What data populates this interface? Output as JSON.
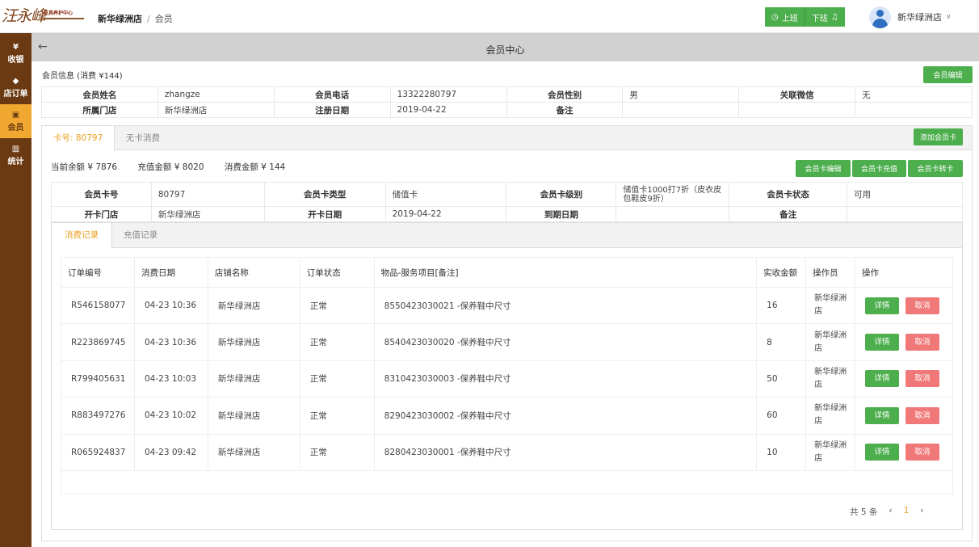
{
  "brand": {
    "logo_script": "汪永峰",
    "logo_sub": "皮具养护中心",
    "logo_tiny": "· · ·",
    "accent": "#6b3a12",
    "active": "#f0a830",
    "green": "#4cae4c"
  },
  "header": {
    "store": "新华绿洲店",
    "separator": "/",
    "page": "会员",
    "shift_on": "上班",
    "shift_off": "下班",
    "user": "新华绿洲店"
  },
  "sidebar": [
    {
      "icon": "¥",
      "label": "收银"
    },
    {
      "icon": "◆",
      "label": "店订单"
    },
    {
      "icon": "▣",
      "label": "会员"
    },
    {
      "icon": "▥",
      "label": "统计"
    }
  ],
  "page_title": "会员中心",
  "member": {
    "section_title": "会员信息 (消费 ¥144)",
    "edit_button": "会员编辑",
    "rows": [
      [
        "会员姓名",
        "zhangze",
        "会员电话",
        "13322280797",
        "会员性别",
        "男",
        "关联微信",
        "无"
      ],
      [
        "所属门店",
        "新华绿洲店",
        "注册日期",
        "2019-04-22",
        "备注",
        "",
        "",
        ""
      ]
    ]
  },
  "card": {
    "tab_active": "卡号: 80797",
    "tab_inactive": "无卡消费",
    "add_button": "添加会员卡",
    "balance": "当前余额 ¥ 7876",
    "recharge_total": "充值金额 ¥ 8020",
    "spend_total": "消费金额 ¥ 144",
    "btn_edit": "会员卡编辑",
    "btn_recharge": "会员卡充值",
    "btn_transfer": "会员卡转卡",
    "rows": [
      [
        "会员卡号",
        "80797",
        "会员卡类型",
        "储值卡",
        "会员卡级别",
        "储值卡1000打7折（皮衣皮包鞋皮9折）",
        "会员卡状态",
        "可用"
      ],
      [
        "开卡门店",
        "新华绿洲店",
        "开卡日期",
        "2019-04-22",
        "到期日期",
        "",
        "备注",
        ""
      ]
    ]
  },
  "records": {
    "tab_active": "消费记录",
    "tab_inactive": "充值记录",
    "columns": [
      "订单编号",
      "消费日期",
      "店铺名称",
      "订单状态",
      "物品-服务项目[备注]",
      "实收金额",
      "操作员",
      "操作"
    ],
    "detail_label": "详情",
    "cancel_label": "取消",
    "orders": [
      [
        "R546158077",
        "04-23 10:36",
        "新华绿洲店",
        "正常",
        "8550423030021 -保养鞋中尺寸",
        "16",
        "新华绿洲店"
      ],
      [
        "R223869745",
        "04-23 10:36",
        "新华绿洲店",
        "正常",
        "8540423030020 -保养鞋中尺寸",
        "8",
        "新华绿洲店"
      ],
      [
        "R799405631",
        "04-23 10:03",
        "新华绿洲店",
        "正常",
        "8310423030003 -保养鞋中尺寸",
        "50",
        "新华绿洲店"
      ],
      [
        "R883497276",
        "04-23 10:02",
        "新华绿洲店",
        "正常",
        "8290423030002 -保养鞋中尺寸",
        "60",
        "新华绿洲店"
      ],
      [
        "R065924837",
        "04-23 09:42",
        "新华绿洲店",
        "正常",
        "8280423030001 -保养鞋中尺寸",
        "10",
        "新华绿洲店"
      ]
    ]
  },
  "pager": {
    "total": "共 5 条",
    "prev": "‹",
    "current": "1",
    "next": "›"
  }
}
